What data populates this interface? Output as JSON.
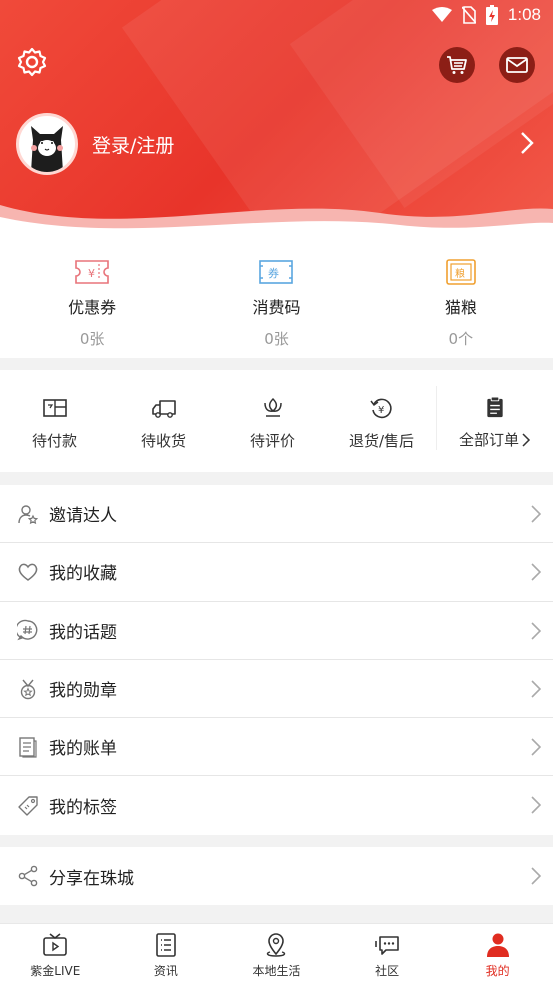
{
  "status": {
    "time": "1:08"
  },
  "profile": {
    "login_label": "登录/注册"
  },
  "wallet": [
    {
      "label": "优惠券",
      "count": "0张",
      "icon": "coupon-icon",
      "color": "#e8737a"
    },
    {
      "label": "消费码",
      "count": "0张",
      "icon": "voucher-icon",
      "color": "#5aa6e0"
    },
    {
      "label": "猫粮",
      "count": "0个",
      "icon": "cat-food-icon",
      "color": "#f0a030"
    }
  ],
  "orders": [
    {
      "label": "待付款",
      "icon": "wallet-icon"
    },
    {
      "label": "待收货",
      "icon": "truck-icon"
    },
    {
      "label": "待评价",
      "icon": "flower-icon"
    },
    {
      "label": "退货/售后",
      "icon": "refund-icon"
    },
    {
      "label": "全部订单",
      "icon": "clipboard-icon"
    }
  ],
  "menu1": [
    {
      "label": "邀请达人",
      "icon": "invite-user-icon"
    },
    {
      "label": "我的收藏",
      "icon": "heart-icon"
    },
    {
      "label": "我的话题",
      "icon": "hashtag-icon"
    },
    {
      "label": "我的勋章",
      "icon": "medal-icon"
    },
    {
      "label": "我的账单",
      "icon": "bill-icon"
    },
    {
      "label": "我的标签",
      "icon": "tag-icon"
    }
  ],
  "menu2": [
    {
      "label": "分享在珠城",
      "icon": "share-icon"
    }
  ],
  "nav": [
    {
      "label": "紫金LIVE",
      "icon": "tv-icon",
      "active": false
    },
    {
      "label": "资讯",
      "icon": "news-icon",
      "active": false
    },
    {
      "label": "本地生活",
      "icon": "location-icon",
      "active": false
    },
    {
      "label": "社区",
      "icon": "chat-icon",
      "active": false
    },
    {
      "label": "我的",
      "icon": "person-icon",
      "active": true
    }
  ],
  "colors": {
    "brand": "#e8342a",
    "active": "#e02c20"
  }
}
